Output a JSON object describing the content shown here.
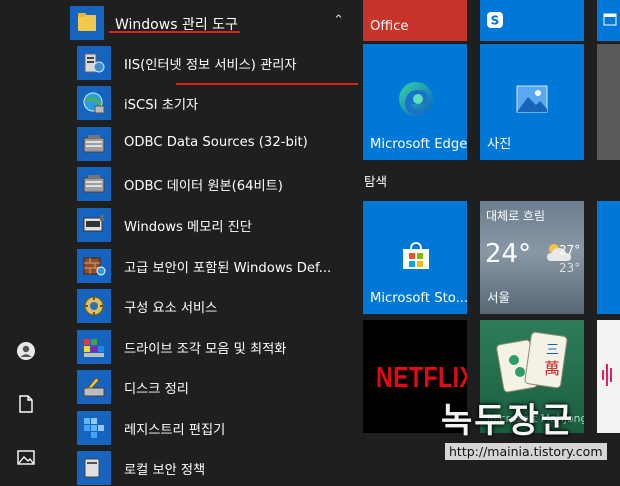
{
  "start_menu": {
    "group": {
      "label": "Windows 관리 도구",
      "expanded": true
    },
    "items": [
      {
        "label": "IIS(인터넷 정보 서비스) 관리자",
        "icon": "iis-manager-icon"
      },
      {
        "label": "iSCSI 초기자",
        "icon": "iscsi-globe-icon"
      },
      {
        "label": "ODBC Data Sources (32-bit)",
        "icon": "odbc-icon"
      },
      {
        "label": "ODBC 데이터 원본(64비트)",
        "icon": "odbc-icon"
      },
      {
        "label": "Windows 메모리 진단",
        "icon": "memory-chip-icon"
      },
      {
        "label": "고급 보안이 포함된 Windows Def...",
        "icon": "firewall-icon"
      },
      {
        "label": "구성 요소 서비스",
        "icon": "component-services-icon"
      },
      {
        "label": "드라이브 조각 모음 및 최적화",
        "icon": "defrag-icon"
      },
      {
        "label": "디스크 정리",
        "icon": "disk-cleanup-icon"
      },
      {
        "label": "레지스트리 편집기",
        "icon": "registry-cubes-icon"
      },
      {
        "label": "로컬 보안 정책",
        "icon": "local-security-policy-icon"
      }
    ]
  },
  "rail": {
    "icons": [
      "user-icon",
      "document-icon",
      "pictures-icon"
    ]
  },
  "tiles": {
    "office": "Office",
    "edge": "Microsoft Edge",
    "photos": "사진",
    "section_title": "탐색",
    "store": "Microsoft Sto...",
    "weather": {
      "condition": "대체로 흐림",
      "temp": "24°",
      "high": "27°",
      "low": "23°",
      "city": "서울"
    },
    "netflix": "NETFLIX",
    "mahjong": "Microsoft Mahjong"
  },
  "watermark": {
    "text": "녹두장군",
    "url": "http://mainia.tistory.com"
  },
  "colors": {
    "tile_blue": "#0078d7",
    "app_icon_blue": "#1565c0",
    "annotation_red": "#e02020",
    "background": "#1f1f1f"
  }
}
